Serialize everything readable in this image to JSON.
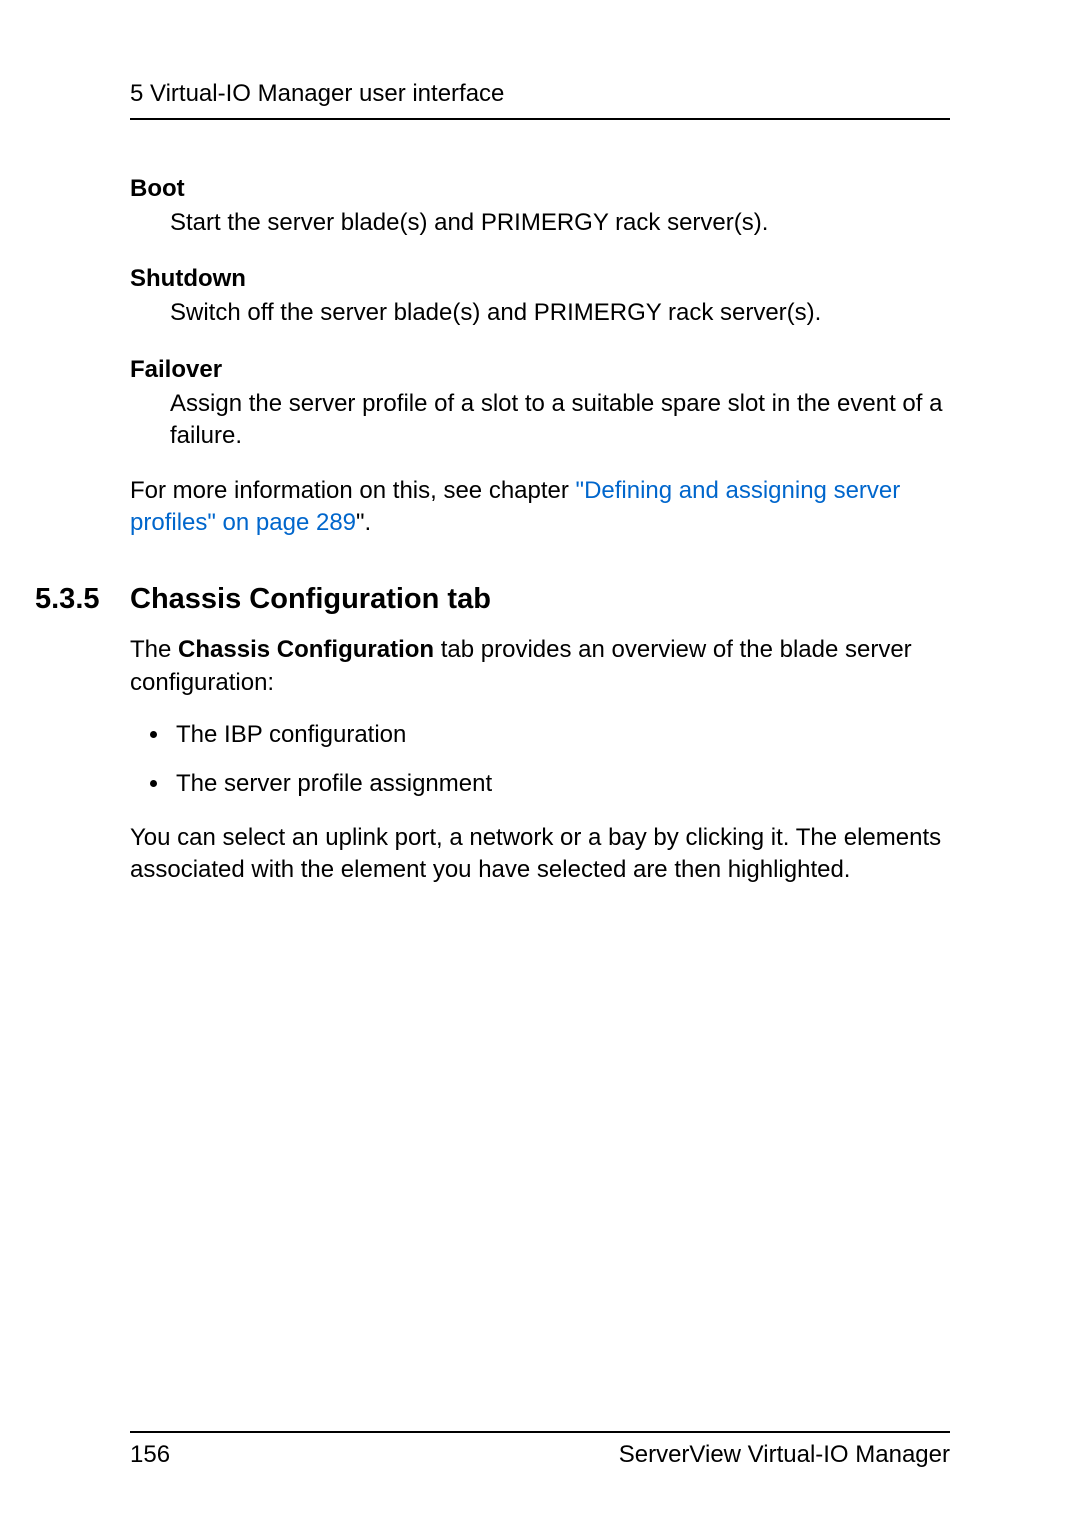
{
  "header": {
    "running_head": "5 Virtual-IO Manager user interface"
  },
  "defs": {
    "boot": {
      "term": "Boot",
      "desc": "Start the server blade(s) and PRIMERGY rack server(s)."
    },
    "shutdown": {
      "term": "Shutdown",
      "desc": "Switch off the server blade(s) and PRIMERGY rack server(s)."
    },
    "failover": {
      "term": "Failover",
      "desc": "Assign the server profile of a slot to a suitable spare slot in the event of a failure."
    }
  },
  "more_info": {
    "prefix": "For more information on this, see chapter ",
    "link": "\"Defining and assigning server profiles\" on page 289",
    "suffix": "\"."
  },
  "section": {
    "num": "5.3.5",
    "title": "Chassis Configuration tab"
  },
  "intro": {
    "prefix": "The ",
    "bold": "Chassis Configuration",
    "suffix": " tab provides an overview of the blade server configuration:"
  },
  "bullets": [
    "The IBP configuration",
    "The server profile assignment"
  ],
  "closing": "You can select an uplink port, a network or a bay by clicking it. The elements associated with the element you have selected are then highlighted.",
  "footer": {
    "page": "156",
    "product": "ServerView Virtual-IO Manager"
  }
}
